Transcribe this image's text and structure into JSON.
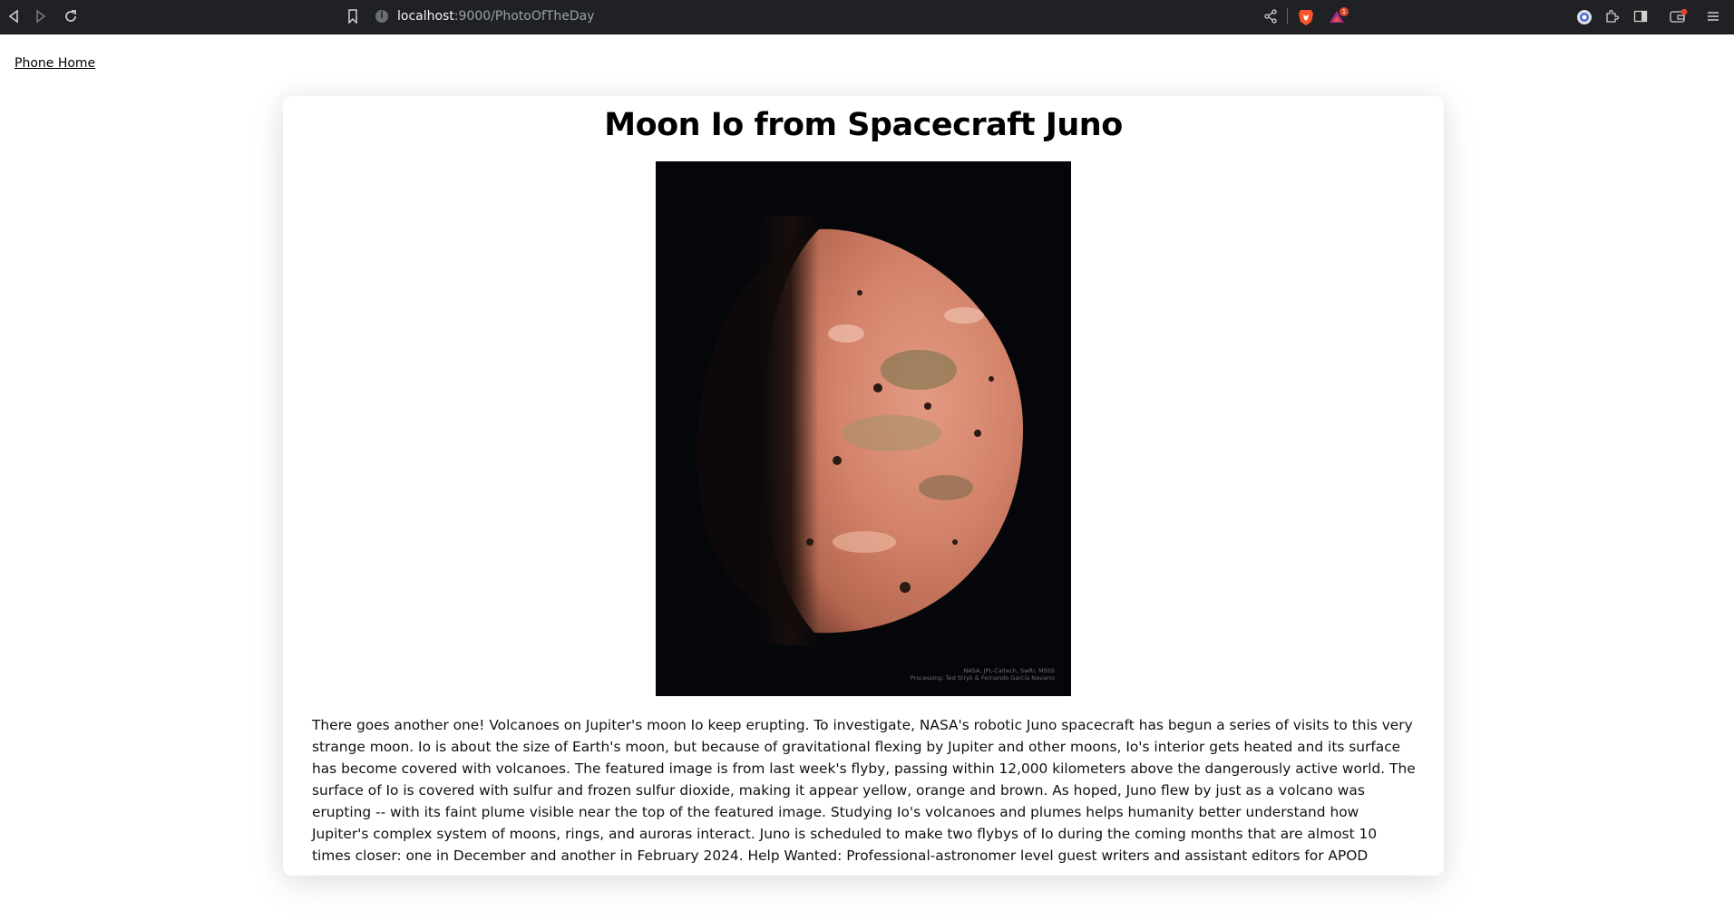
{
  "browser": {
    "url_host": "localhost",
    "url_path": ":9000/PhotoOfTheDay",
    "tab_badge_count": "1",
    "icons": [
      "back-icon",
      "forward-icon",
      "reload-icon",
      "bookmark-icon",
      "site-info-icon",
      "share-icon",
      "brave-shield-icon",
      "brave-rewards-icon",
      "account-icon",
      "extensions-icon",
      "sidebar-icon",
      "wallet-icon",
      "menu-icon"
    ]
  },
  "nav": {
    "phone_home": "Phone Home"
  },
  "article": {
    "title": "Moon Io from Spacecraft Juno",
    "image_credit_1": "NASA, JPL-Caltech, SwRI, MSSS",
    "image_credit_2": "Processing: Ted Stryk & Fernando Garcia Navarro",
    "description": "There goes another one! Volcanoes on Jupiter's moon Io keep erupting. To investigate, NASA's robotic Juno spacecraft has begun a series of visits to this very strange moon. Io is about the size of Earth's moon, but because of gravitational flexing by Jupiter and other moons, Io's interior gets heated and its surface has become covered with volcanoes. The featured image is from last week's flyby, passing within 12,000 kilometers above the dangerously active world. The surface of Io is covered with sulfur and frozen sulfur dioxide, making it appear yellow, orange and brown. As hoped, Juno flew by just as a volcano was erupting -- with its faint plume visible near the top of the featured image. Studying Io's volcanoes and plumes helps humanity better understand how Jupiter's complex system of moons, rings, and auroras interact. Juno is scheduled to make two flybys of Io during the coming months that are almost 10 times closer: one in December and another in February 2024. Help Wanted: Professional-astronomer level guest writers and assistant editors for APOD"
  },
  "colors": {
    "chrome_bg": "#202124",
    "brave_orange": "#fb542b",
    "io_surface": "#d9826a",
    "space_bg": "#05060a"
  }
}
